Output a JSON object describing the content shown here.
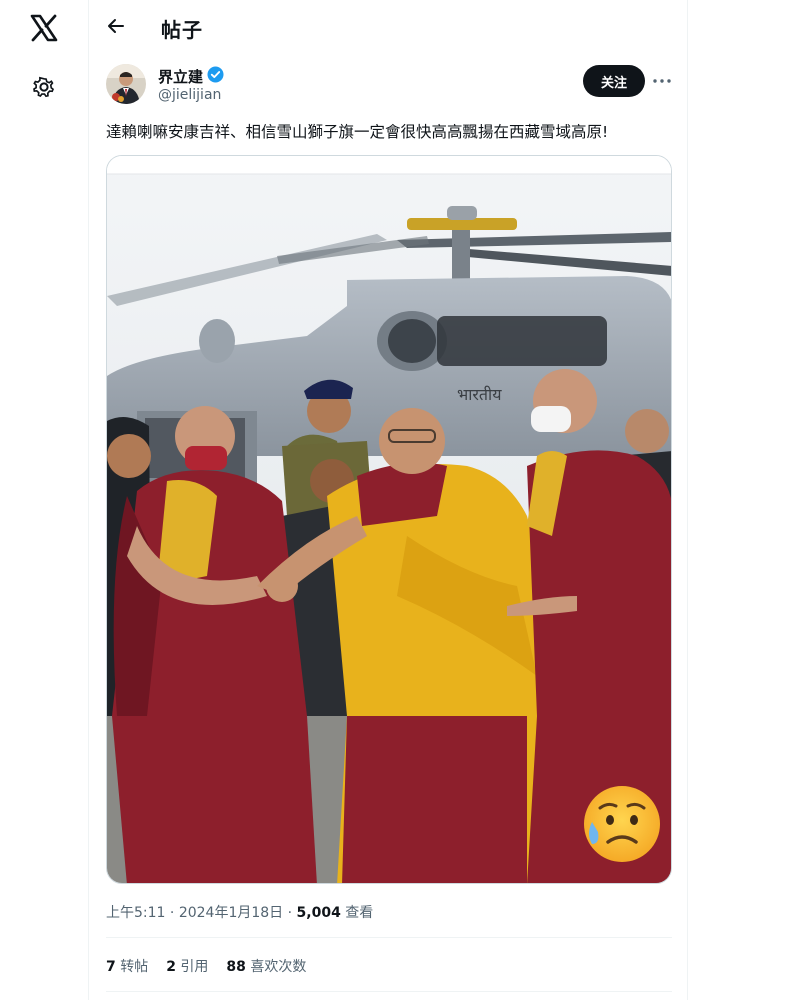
{
  "header": {
    "title": "帖子"
  },
  "author": {
    "name": "界立建",
    "handle": "@jielijian",
    "follow_label": "关注"
  },
  "post": {
    "text": "達賴喇嘛安康吉祥、相信雪山獅子旗一定會很快高高飄揚在西藏雪域高原!",
    "time": "上午5:11",
    "date": "2024年1月18日",
    "views_count": "5,004",
    "views_label": "查看",
    "image_emoji": "😥"
  },
  "stats": {
    "reposts_count": "7",
    "reposts_label": "转帖",
    "quotes_count": "2",
    "quotes_label": "引用",
    "likes_count": "88",
    "likes_label": "喜欢次数"
  },
  "colors": {
    "text": "#0f1419",
    "muted": "#536471",
    "verified": "#1d9bf0",
    "robe_yellow": "#e8b21c",
    "robe_maroon": "#8d1f2c"
  }
}
